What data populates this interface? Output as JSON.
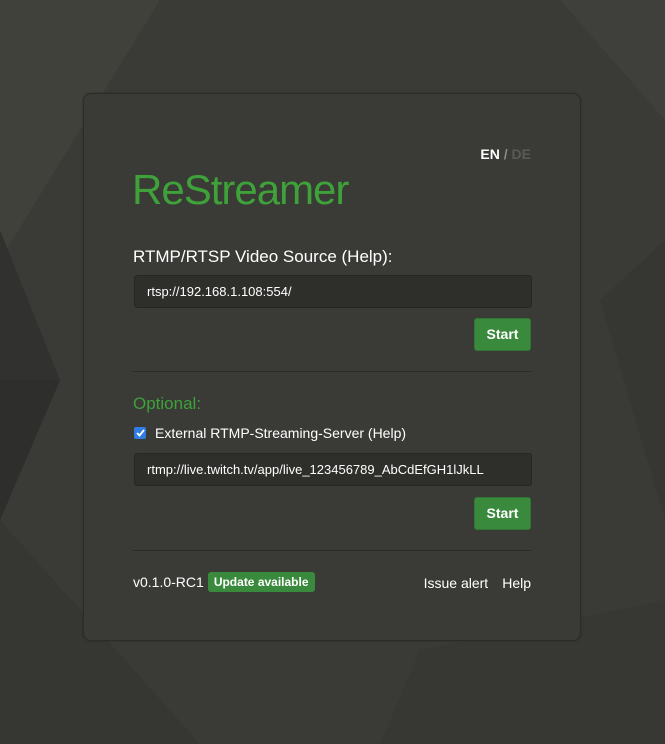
{
  "header": {
    "lang_en": "EN",
    "lang_sep": " / ",
    "lang_de": "DE",
    "app_title": "ReStreamer"
  },
  "source": {
    "label": "RTMP/RTSP Video Source (Help):",
    "value": "rtsp://192.168.1.108:554/",
    "start_label": "Start"
  },
  "optional": {
    "heading": "Optional:",
    "checkbox_label": "External RTMP-Streaming-Server (Help)",
    "checkbox_checked": true,
    "value": "rtmp://live.twitch.tv/app/live_123456789_AbCdEfGH1lJkLL",
    "start_label": "Start"
  },
  "footer": {
    "version": "v0.1.0-RC1",
    "update_badge": "Update available",
    "issue_alert": "Issue alert",
    "help": "Help"
  },
  "colors": {
    "background": "#3a3a36",
    "accent_green": "#3ea13a",
    "button_green": "#3a8a3e",
    "checkbox_blue": "#2f7de1"
  }
}
